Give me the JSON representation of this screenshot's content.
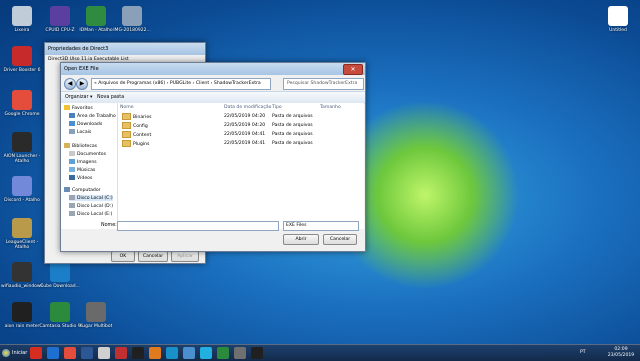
{
  "desktop": {
    "icons": [
      {
        "label": "Lixeira",
        "color": "#c0ccd8"
      },
      {
        "label": "CPUID CPU-Z",
        "color": "#5a3fa0"
      },
      {
        "label": "IDMan - Atalho",
        "color": "#2e8b3f"
      },
      {
        "label": "IMG-20180922...",
        "color": "#8aa0b8"
      },
      {
        "label": "Driver Booster 6",
        "color": "#c62a2a"
      },
      {
        "label": "Google Chrome",
        "color": "#e44c3c"
      },
      {
        "label": "AION Launcher - Atalho",
        "color": "#2a2a2a"
      },
      {
        "label": "Discord - Atalho",
        "color": "#7289da"
      },
      {
        "label": "LeagueClient - Atalho",
        "color": "#b89a4a"
      },
      {
        "label": "wifiaudio_windows",
        "color": "#333333"
      },
      {
        "label": "Cube Download...",
        "color": "#1a7fc8"
      },
      {
        "label": "aion rain meter",
        "color": "#202020"
      },
      {
        "label": "Camtasia Studio 9",
        "color": "#2c8a3c"
      },
      {
        "label": "Kugar Multibot",
        "color": "#6a6a6a"
      },
      {
        "label": "Untitled",
        "color": "#ffffff"
      }
    ],
    "behind_dialog_title": "Propriedades de Direct3",
    "behind_dialog_subtitle": "Direct3D Ulso 11.ia Executable List",
    "behind_buttons": {
      "ok": "OK",
      "cancel": "Cancelar",
      "apply": "Aplicar"
    }
  },
  "dialog": {
    "title": "Open EXE File",
    "close_glyph": "✕",
    "back_glyph": "◀",
    "forward_glyph": "▶",
    "address": "« Arquivos de Programas (x86) › PUBGLite › Client › ShadowTrackerExtra",
    "search_placeholder": "Pesquisar ShadowTrackerExtra",
    "toolbar": {
      "organize": "Organizar ▾",
      "new_folder": "Nova pasta"
    },
    "nav": {
      "favorites": "Favoritos",
      "desktop": "Área de Trabalho",
      "downloads": "Downloads",
      "recent": "Locais",
      "libraries": "Bibliotecas",
      "documents": "Documentos",
      "images": "Imagens",
      "music": "Músicas",
      "videos": "Vídeos",
      "computer": "Computador",
      "disk_c": "Disco Local (C:)",
      "disk_d": "Disco Local (D:)",
      "disk_e": "Disco Local (E:)"
    },
    "columns": {
      "name": "Nome",
      "modified": "Data de modificação",
      "type": "Tipo",
      "size": "Tamanho"
    },
    "files": [
      {
        "name": "Binaries",
        "modified": "22/05/2019 04:20",
        "type": "Pasta de arquivos"
      },
      {
        "name": "Config",
        "modified": "22/05/2019 04:20",
        "type": "Pasta de arquivos"
      },
      {
        "name": "Content",
        "modified": "22/05/2019 04:41",
        "type": "Pasta de arquivos"
      },
      {
        "name": "Plugins",
        "modified": "22/05/2019 04:41",
        "type": "Pasta de arquivos"
      }
    ],
    "filename_label": "Nome:",
    "filename_value": "",
    "filter": "EXE Files",
    "open_button": "Abrir",
    "cancel_button": "Cancelar"
  },
  "taskbar": {
    "start_label": "Iniciar",
    "language": "PT",
    "time": "02:09",
    "date": "23/05/2019",
    "apps": [
      "#d62d20",
      "#1f6fd1",
      "#e44c3c",
      "#2b5797",
      "#d0d0d0",
      "#c03030",
      "#202020",
      "#e07a1f",
      "#1a90c8",
      "#4a8fd0",
      "#22b0e0",
      "#2c8a3c",
      "#707070",
      "#202020"
    ]
  }
}
